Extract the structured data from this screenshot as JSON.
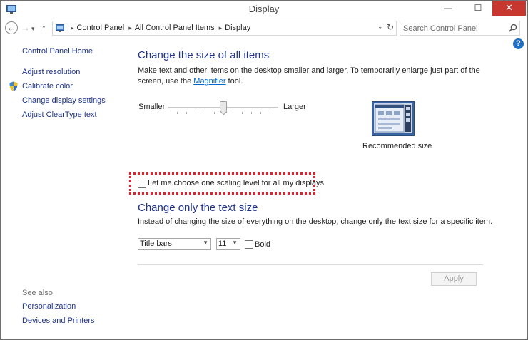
{
  "window": {
    "title": "Display",
    "controls": {
      "minimize": "—",
      "maximize": "☐",
      "close": "✕"
    }
  },
  "address": {
    "back": "←",
    "forward": "→",
    "history": "▾",
    "up": "↑",
    "breadcrumbs": [
      "Control Panel",
      "All Control Panel Items",
      "Display"
    ],
    "separator": "▸",
    "dropdown": "⌄",
    "refresh": "↻",
    "search_placeholder": "Search Control Panel"
  },
  "sidebar": {
    "home": "Control Panel Home",
    "items": [
      "Adjust resolution",
      "Calibrate color",
      "Change display settings",
      "Adjust ClearType text"
    ],
    "see_also_label": "See also",
    "see_also": [
      "Personalization",
      "Devices and Printers"
    ]
  },
  "help": "?",
  "main": {
    "section1": {
      "heading": "Change the size of all items",
      "description_before": "Make text and other items on the desktop smaller and larger. To temporarily enlarge just part of the screen, use the ",
      "link": "Magnifier",
      "description_after": " tool.",
      "slider": {
        "min_label": "Smaller",
        "max_label": "Larger",
        "value_fraction": 0.47
      },
      "preview_caption": "Recommended size"
    },
    "scaling_checkbox": {
      "label": "Let me choose one scaling level for all my displays",
      "checked": false
    },
    "section2": {
      "heading": "Change only the text size",
      "description": "Instead of changing the size of everything on the desktop, change only the text size for a specific item.",
      "element_select": {
        "value": "Title bars"
      },
      "size_select": {
        "value": "11"
      },
      "bold": {
        "label": "Bold",
        "checked": false
      }
    },
    "apply": "Apply"
  },
  "colors": {
    "link": "#1e3287",
    "heading": "#1e3287",
    "close_button": "#c7372f",
    "highlight": "#e0202a",
    "help": "#1f6fc5"
  }
}
